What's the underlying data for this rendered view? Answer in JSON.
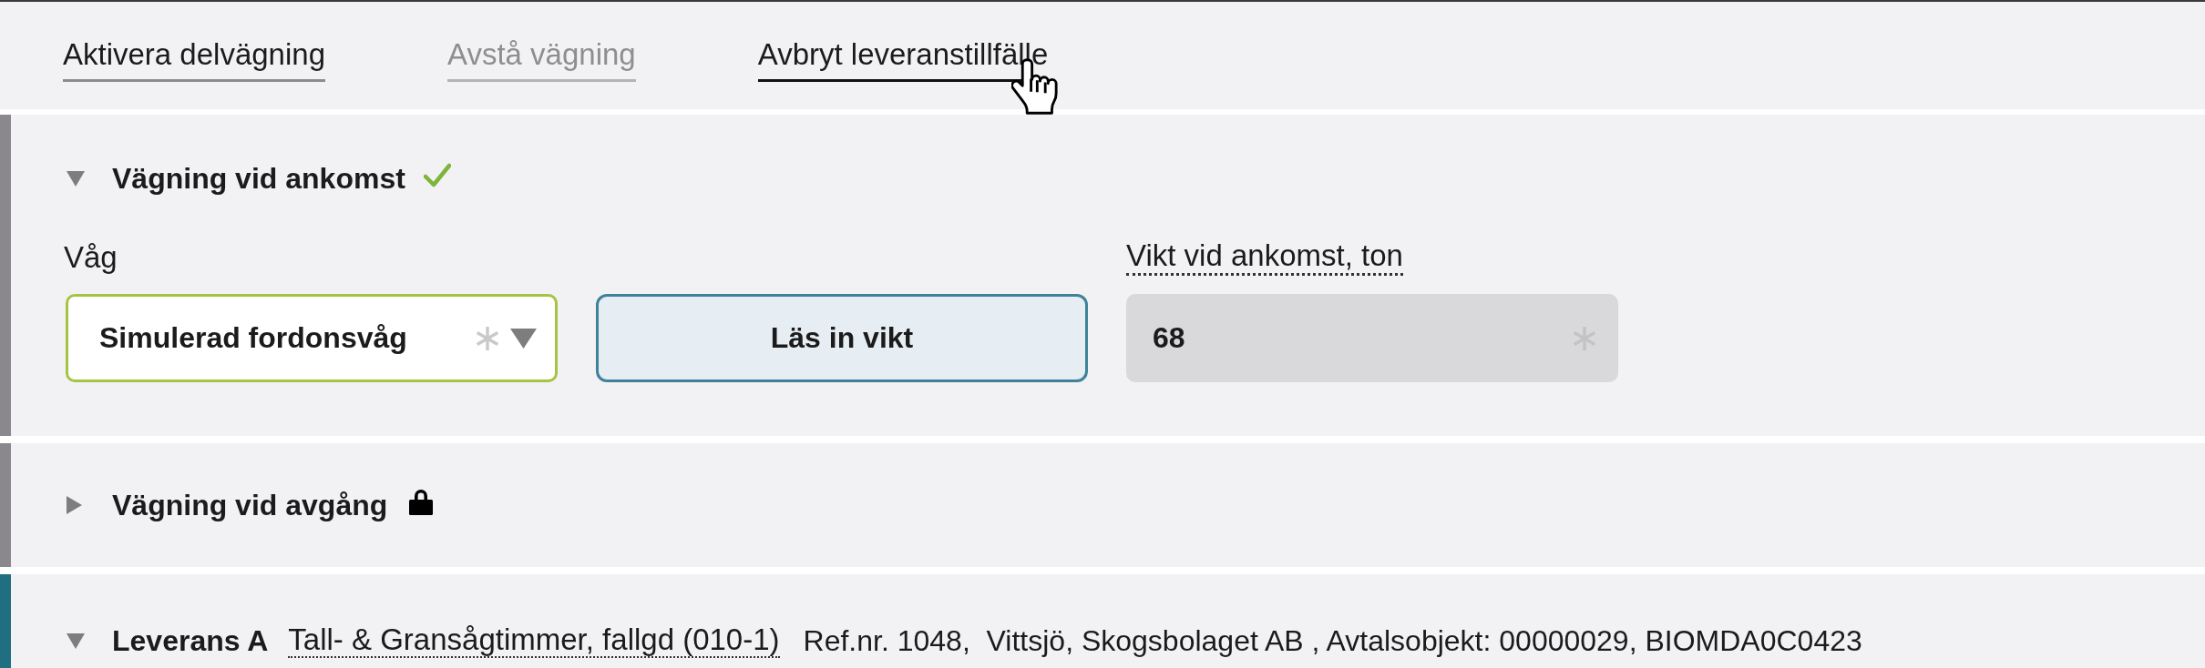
{
  "actions": [
    {
      "label": "Aktivera delvägning",
      "disabled": false,
      "hovered": false
    },
    {
      "label": "Avstå vägning",
      "disabled": true,
      "hovered": false
    },
    {
      "label": "Avbryt leveranstillfälle",
      "disabled": false,
      "hovered": true
    }
  ],
  "sections": [
    {
      "kind": "weighing",
      "title": "Vägning vid ankomst",
      "expanded": true,
      "complete": true,
      "locked": false,
      "color": "#8a888c",
      "scale": {
        "label": "Våg",
        "value": "Simulerad fordonsvåg",
        "required": true,
        "valid": true
      },
      "read_button": {
        "label": "Läs in vikt"
      },
      "weight": {
        "label": "Vikt vid ankomst, ton",
        "value": "68",
        "required": true,
        "readonly": true
      }
    },
    {
      "kind": "weighing",
      "title": "Vägning vid avgång",
      "expanded": false,
      "complete": false,
      "locked": true,
      "color": "#8a888c"
    },
    {
      "kind": "delivery",
      "title": "Leverans A",
      "expanded": true,
      "color": "#1f6f80",
      "product": "Tall- & Gransågtimmer, fallgd (010-1)",
      "details": "Ref.nr. 1048,  Vittsjö, Skogsbolaget AB , Avtalsobjekt: 00000029, BIOMDA0C0423"
    }
  ]
}
